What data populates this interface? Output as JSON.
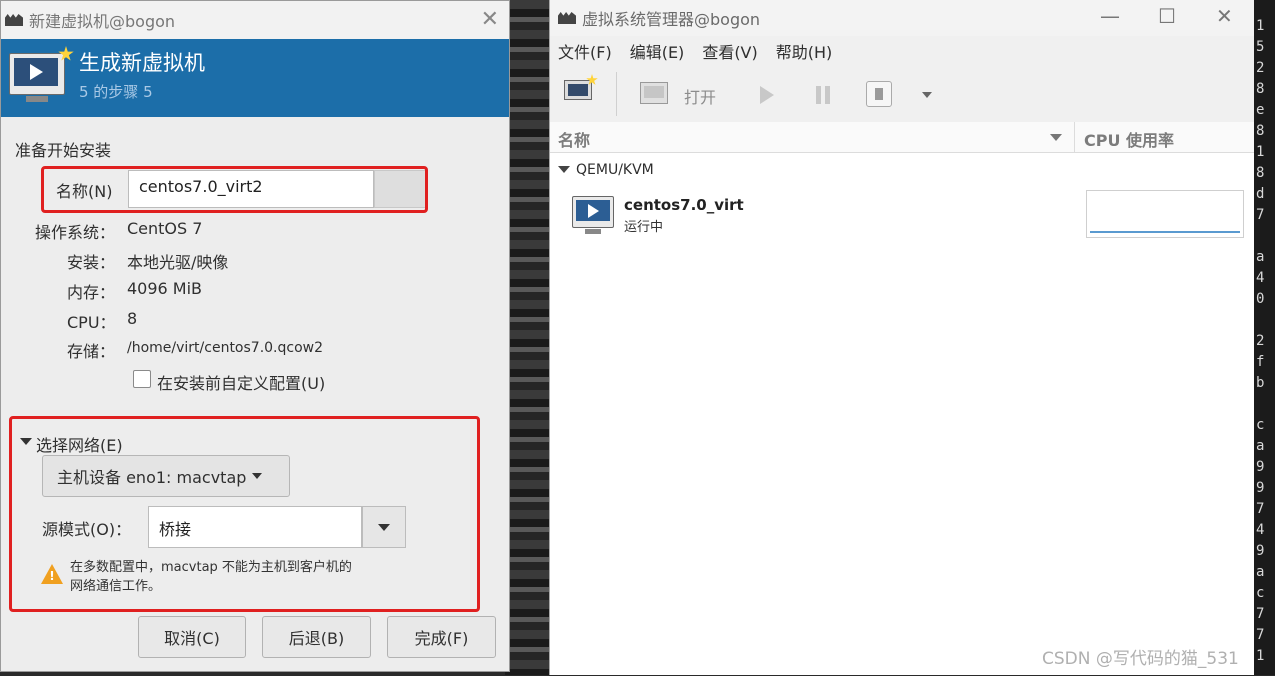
{
  "dialog": {
    "title": "新建虚拟机@bogon",
    "close_glyph": "✕",
    "banner_title": "生成新虚拟机",
    "banner_subtitle": "5 的步骤 5",
    "section_title": "准备开始安装",
    "name_label": "名称(N)",
    "name_value": "centos7.0_virt2",
    "os_label": "操作系统：",
    "os_value": "CentOS 7",
    "install_label": "安装：",
    "install_value": "本地光驱/映像",
    "memory_label": "内存：",
    "memory_value": "4096 MiB",
    "cpu_label": "CPU：",
    "cpu_value": "8",
    "storage_label": "存储：",
    "storage_value": "/home/virt/centos7.0.qcow2",
    "customize_label": "在安装前自定义配置(U)",
    "customize_checked": false,
    "network_expander": "选择网络(E)",
    "host_device": "主机设备 eno1: macvtap",
    "source_mode_label": "源模式(O)：",
    "source_mode_value": "桥接",
    "warning_line1": "在多数配置中，macvtap 不能为主机到客户机的",
    "warning_line2": "网络通信工作。",
    "buttons": {
      "cancel": "取消(C)",
      "back": "后退(B)",
      "finish": "完成(F)"
    }
  },
  "manager": {
    "title": "虚拟系统管理器@bogon",
    "window_controls": {
      "minimize": "—",
      "maximize": "☐",
      "close": "✕"
    },
    "menus": [
      "文件(F)",
      "编辑(E)",
      "查看(V)",
      "帮助(H)"
    ],
    "toolbar_open": "打开",
    "columns": {
      "name": "名称",
      "cpu": "CPU 使用率"
    },
    "group": "QEMU/KVM",
    "vm": {
      "name": "centos7.0_virt",
      "status": "运行中"
    }
  },
  "terminal_chars": "1\n5\n2\n8\ne\n8\n1\n8\nd\n7\n\na\n4\n0\n\n2\nf\nb\n\nc\na\n9\n9\n7\n4\n9\na\nc\n7\n7\n1",
  "watermark": "CSDN @写代码的猫_531",
  "colors": {
    "banner": "#1c6ea9",
    "highlight_box": "#e02020",
    "warning": "#f0a020"
  },
  "icons": [
    "app-icon",
    "new-vm-monitor-icon",
    "close-icon",
    "warning-icon",
    "vm-monitor-icon",
    "play-icon",
    "pause-icon",
    "stop-icon"
  ]
}
